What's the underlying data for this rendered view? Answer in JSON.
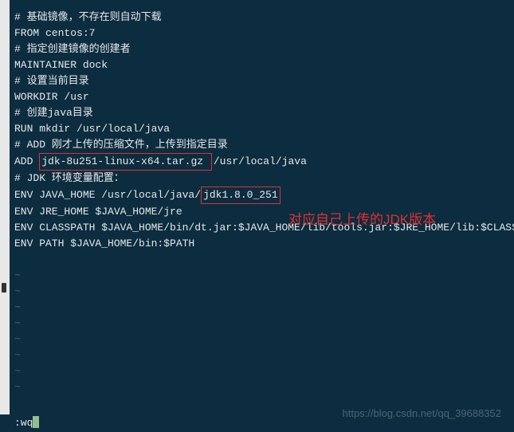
{
  "editor": {
    "lines": [
      "# 基础镜像，不存在则自动下载",
      "FROM centos:7",
      "# 指定创建镜像的创建者",
      "MAINTAINER dock",
      "# 设置当前目录",
      "WORKDIR /usr",
      "# 创建java目录",
      "RUN mkdir /usr/local/java",
      "# ADD 刚才上传的压缩文件，上传到指定目录",
      "",
      "# JDK 环境变量配置：",
      "",
      "ENV JRE_HOME $JAVA_HOME/jre",
      "ENV CLASSPATH $JAVA_HOME/bin/dt.jar:$JAVA_HOME/lib/tools.jar:$JRE_HOME/lib:$CLASSPATH",
      "ENV PATH $JAVA_HOME/bin:$PATH"
    ],
    "add_line": {
      "prefix": "ADD ",
      "highlighted": "jdk-8u251-linux-x64.tar.gz ",
      "suffix": "/usr/local/java"
    },
    "env_line": {
      "prefix": "ENV JAVA_HOME /usr/local/java/",
      "highlighted": "jdk1.8.0_251"
    },
    "tilde_count": 8,
    "tilde_char": "~"
  },
  "annotation": {
    "text": "对应自己上传的JDK版本"
  },
  "status": {
    "command": ":wq"
  },
  "watermark": {
    "text": "https://blog.csdn.net/qq_39688352"
  }
}
